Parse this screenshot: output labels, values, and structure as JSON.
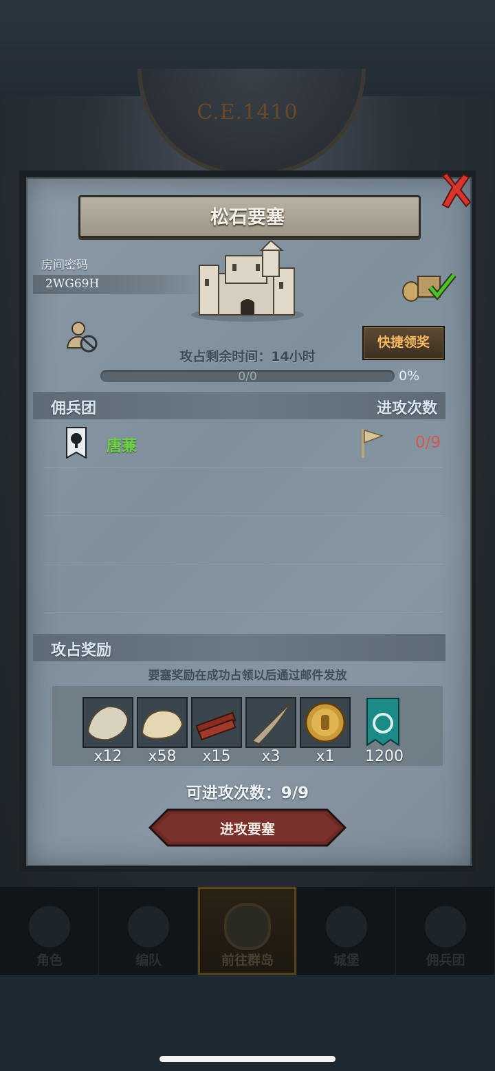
{
  "background": {
    "era_label": "C.E.1410"
  },
  "nav": {
    "items": [
      {
        "label": "角色",
        "icon": "knight-icon"
      },
      {
        "label": "编队",
        "icon": "helmet-icon"
      },
      {
        "label": "前往群岛",
        "icon": "compass-map-icon",
        "active": true
      },
      {
        "label": "城堡",
        "icon": "castle-icon"
      },
      {
        "label": "佣兵团",
        "icon": "ship-icon"
      }
    ]
  },
  "dialog": {
    "title": "松石要塞",
    "room_code_label": "房间密码",
    "room_code": "2WG69H",
    "quick_claim": "快捷领奖",
    "remaining_time": "攻占剩余时间：14小时",
    "progress_value": "0/0",
    "progress_fraction": 0,
    "progress_percent": "0%",
    "mercenary_header": "佣兵团",
    "attack_count_header": "进攻次数",
    "members": [
      {
        "name": "唐蒹",
        "attacks": "0/9"
      }
    ],
    "rewards_header": "攻占奖励",
    "rewards_note": "要塞奖励在成功占领以后通过邮件发放",
    "rewards": [
      {
        "icon": "fur-pelt-icon",
        "qty": "x12"
      },
      {
        "icon": "wool-fleece-icon",
        "qty": "x58"
      },
      {
        "icon": "wood-planks-icon",
        "qty": "x15"
      },
      {
        "icon": "twisted-horn-icon",
        "qty": "x3"
      },
      {
        "icon": "gold-helmet-coin-icon",
        "qty": "x1"
      },
      {
        "icon": "guild-banner-icon",
        "qty": "1200"
      }
    ],
    "attempts_text": "可进攻次数：9/9",
    "attack_button": "进攻要塞"
  },
  "colors": {
    "member_name": "#6fd14a",
    "attack_count": "#d2584c",
    "quick_claim_text": "#f6b960",
    "attack_button": "#7a2e2a"
  }
}
